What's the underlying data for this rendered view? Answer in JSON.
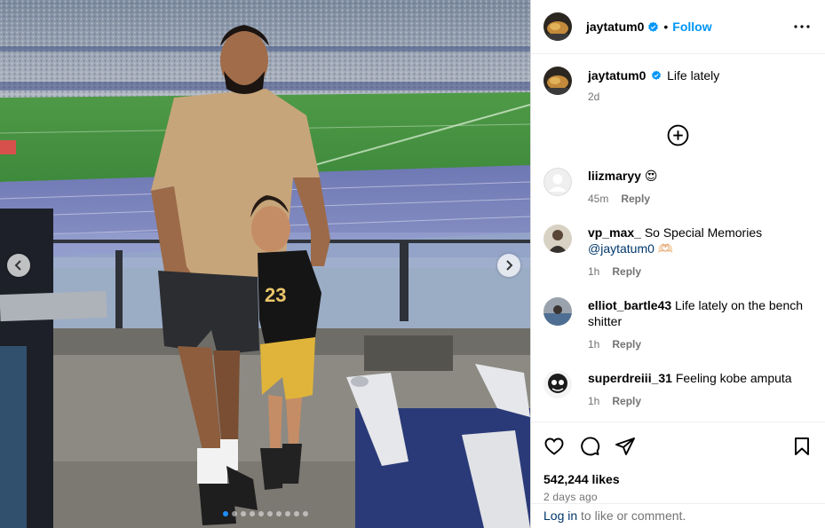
{
  "post": {
    "username": "jaytatum0",
    "follow_label": "Follow",
    "separator": "•",
    "caption": "Life lately",
    "caption_age": "2d",
    "likes": "542,244 likes",
    "posted_ago": "2 days ago"
  },
  "carousel": {
    "image_count": 10,
    "active_index": 0
  },
  "comments": [
    {
      "user": "liizmaryy",
      "text": "😍",
      "age": "45m",
      "reply": "Reply",
      "avatar": "default-avatar"
    },
    {
      "user": "vp_max_",
      "text": "So Special Memories",
      "mention": "@jaytatum0",
      "emoji": "🫶🏻",
      "age": "1h",
      "reply": "Reply",
      "avatar": "photo-avatar"
    },
    {
      "user": "elliot_bartle43",
      "text": "Life lately on the bench shitter",
      "age": "1h",
      "reply": "Reply",
      "avatar": "photo-avatar"
    },
    {
      "user": "superdreiii_31",
      "text": "Feeling kobe amputa",
      "age": "1h",
      "reply": "Reply",
      "avatar": "photo-avatar"
    }
  ],
  "footer": {
    "login_link": "Log in",
    "login_rest": " to like or comment."
  },
  "icons": [
    "chevron-left-icon",
    "chevron-right-icon",
    "verified-badge-icon",
    "more-options-icon",
    "add-circle-icon",
    "heart-icon",
    "comment-icon",
    "share-icon",
    "bookmark-icon"
  ],
  "colors": {
    "link_blue": "#0095f6",
    "verified_blue": "#0095f6",
    "meta_gray": "#737373",
    "active_dot": "#1f8ef7"
  }
}
